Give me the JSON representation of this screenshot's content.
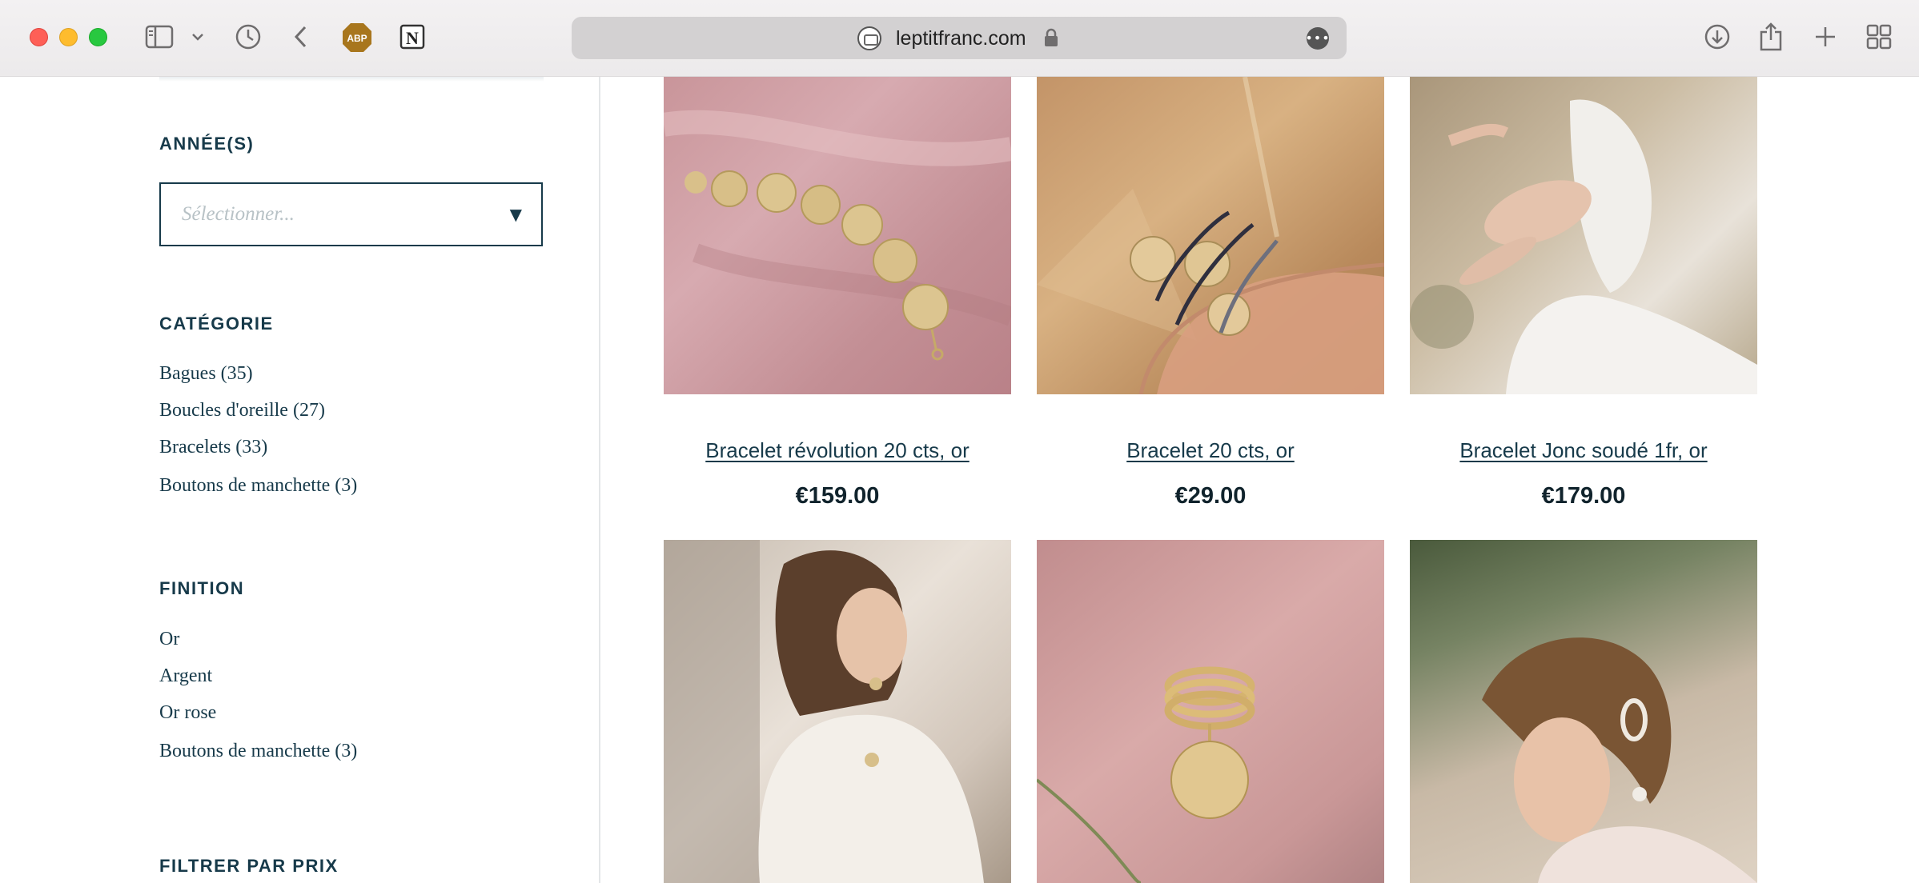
{
  "browser": {
    "url": "leptitfranc.com",
    "abp_label": "ABP",
    "more_label": "•••"
  },
  "sidebar": {
    "years": {
      "heading": "ANNÉE(S)",
      "select_placeholder": "Sélectionner..."
    },
    "category": {
      "heading": "CATÉGORIE",
      "items": [
        "Bagues (35)",
        "Boucles d'oreille (27)",
        "Bracelets (33)",
        "Boutons de manchette (3)"
      ]
    },
    "finish": {
      "heading": "FINITION",
      "items": [
        "Or",
        "Argent",
        "Or rose",
        "Boutons de manchette (3)"
      ]
    },
    "price_filter": {
      "heading": "FILTRER PAR PRIX"
    }
  },
  "products": [
    {
      "title": "Bracelet révolution 20 cts, or",
      "price": "€159.00"
    },
    {
      "title": "Bracelet 20 cts, or",
      "price": "€29.00"
    },
    {
      "title": "Bracelet Jonc soudé 1fr, or",
      "price": "€179.00"
    }
  ],
  "colors": {
    "brand_navy": "#173a4a",
    "price_text": "#10232c"
  }
}
